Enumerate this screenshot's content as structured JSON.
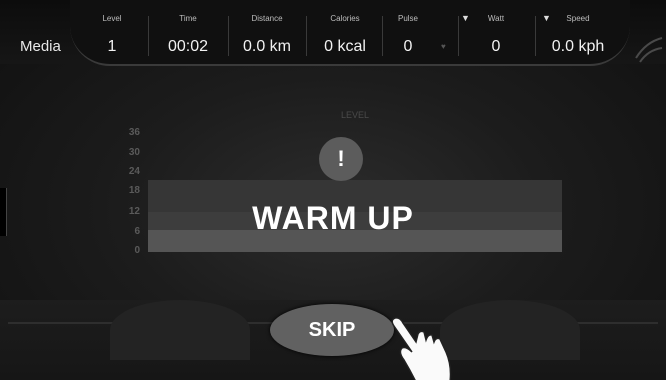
{
  "header": {
    "media_label": "Media",
    "stats": [
      {
        "label": "Level",
        "value": "1"
      },
      {
        "label": "Time",
        "value": "00:02"
      },
      {
        "label": "Distance",
        "value": "0.0 km"
      },
      {
        "label": "Calories",
        "value": "0 kcal"
      },
      {
        "label": "Pulse",
        "value": "0"
      },
      {
        "label": "Watt",
        "value": "0"
      },
      {
        "label": "Speed",
        "value": "0.0 kph"
      }
    ]
  },
  "chart": {
    "title": "LEVEL",
    "yticks": [
      "36",
      "30",
      "24",
      "18",
      "12",
      "6",
      "0"
    ]
  },
  "dialog": {
    "alert_symbol": "!",
    "message": "WARM UP",
    "skip_label": "SKIP"
  }
}
